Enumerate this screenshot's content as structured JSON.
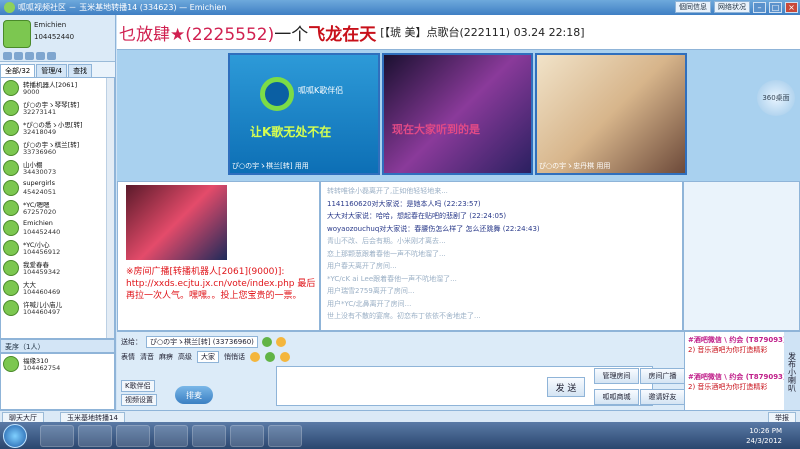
{
  "window": {
    "title": "呱呱视频社区 － 玉米基地转播14 (334623) — Emichien",
    "buttons": [
      "個同信息",
      "网络状况"
    ]
  },
  "self": {
    "nick": "Emichien",
    "id": "104452440"
  },
  "user_tabs": [
    "全部/32",
    "管理/4",
    "查找"
  ],
  "users": [
    {
      "name": "转播机器人[2061]",
      "id": "9000"
    },
    {
      "name": "ぴ○の宇ゝ琴琴[转]",
      "id": "32273141"
    },
    {
      "name": "*ぴ○の悉ゝ小思[转]",
      "id": "32418049"
    },
    {
      "name": "ぴ○の宇ゝ棋兰[转]",
      "id": "33736960"
    },
    {
      "name": "山小棚",
      "id": "34430073"
    },
    {
      "name": "supergirls",
      "id": "45424051"
    },
    {
      "name": "*YC/嗯嗯",
      "id": "67257020"
    },
    {
      "name": "Emichien",
      "id": "104452440"
    },
    {
      "name": "*YC/小心",
      "id": "104456912"
    },
    {
      "name": "我爱春春",
      "id": "104459342"
    },
    {
      "name": "大大",
      "id": "104460469"
    },
    {
      "name": "许喊儿小庙儿",
      "id": "104460497"
    }
  ],
  "managers": {
    "header": "麦序（1人）",
    "users": [
      {
        "name": "福缘310",
        "id": "104462754"
      }
    ]
  },
  "marquee": {
    "part_a": "乜放肆★(2225552)",
    "part_b": "一个",
    "part_c": "飞龙在天",
    "part_d": "[【琥 美】点歌台(222111) 03.24 22:18]"
  },
  "videos": [
    {
      "caption": "ぴ○の宇ゝ棋兰[转]   用用",
      "brand": "呱呱K歌伴侣",
      "slogan": "让K歌无处不在"
    },
    {
      "caption": "",
      "subtitle": "现在大家听到的是"
    },
    {
      "caption": "ぴ○の宇ゝ忠丹棋  用用"
    }
  ],
  "desk360": "360桌面",
  "photo_note": "※房间广播[转播机器人[2061](9000)]: http://xxds.ecjtu.jx.cn/vote/index.php 最后再拉一次人气。嘿嘿。。投上您宝贵的一票。",
  "chat": [
    {
      "text": "转转唯徐小磊离开了,正如他轻轻地来...",
      "cls": "dim"
    },
    {
      "text": "1141160620对大家说：是她本人吗 (22:23:57)",
      "cls": "blue"
    },
    {
      "text": "大大对大家说：哈哈，想起春在贴吧的悲剧了 (22:24:05)",
      "cls": "blue"
    },
    {
      "text": "woyaozouchuq对大家说：春腰伤怎么样了 怎么还跳舞 (22:24:43)",
      "cls": "blue"
    },
    {
      "text": "青山不改、后会有期。小米刚才离去...",
      "cls": "dim"
    },
    {
      "text": "恋上那颗葱跟着春他一声不吭地溜了...",
      "cls": "dim"
    },
    {
      "text": "用户春天离开了房间...",
      "cls": "dim"
    },
    {
      "text": "*YC/cK ai Lee跟着春他一声不吭地溜了...",
      "cls": "dim"
    },
    {
      "text": "用户瑞雪2759离开了房间...",
      "cls": "dim"
    },
    {
      "text": "用户*YC/北鼻离开了房间...",
      "cls": "dim"
    },
    {
      "text": "世上没有不散的宴席。初恋布丁依依不舍地走了...",
      "cls": "dim"
    }
  ],
  "bottom": {
    "send_to_label": "送给：",
    "send_to": "ぴ○の宇ゝ棋兰[转] (33736960)",
    "options": [
      "表情",
      "清音",
      "麻痹",
      "高级",
      "大家",
      "悄悄话"
    ],
    "k_label": "K歌伴侣",
    "video_label": "视频设置",
    "pai_label": "排麦",
    "send": "发 送",
    "btn_manage": "管理房间",
    "btn_broadcast": "房间广播",
    "btn_shop": "呱呱商城",
    "btn_invite": "邀请好友",
    "side_label": "发布小喇叭"
  },
  "ads": [
    {
      "t": "#酒吧微信 \\ 约会 (T879093)",
      "s": "2) 音乐酒吧为你打造精彩"
    },
    {
      "t": "#酒吧微信 \\ 约会 (T879093)",
      "s": "2) 音乐酒吧为你打造精彩"
    }
  ],
  "status_tabs": [
    "聊天大厅",
    "玉米基地转播14"
  ],
  "status_right": "举报",
  "taskbar": {
    "time": "10:26 PM",
    "date": "24/3/2012"
  }
}
